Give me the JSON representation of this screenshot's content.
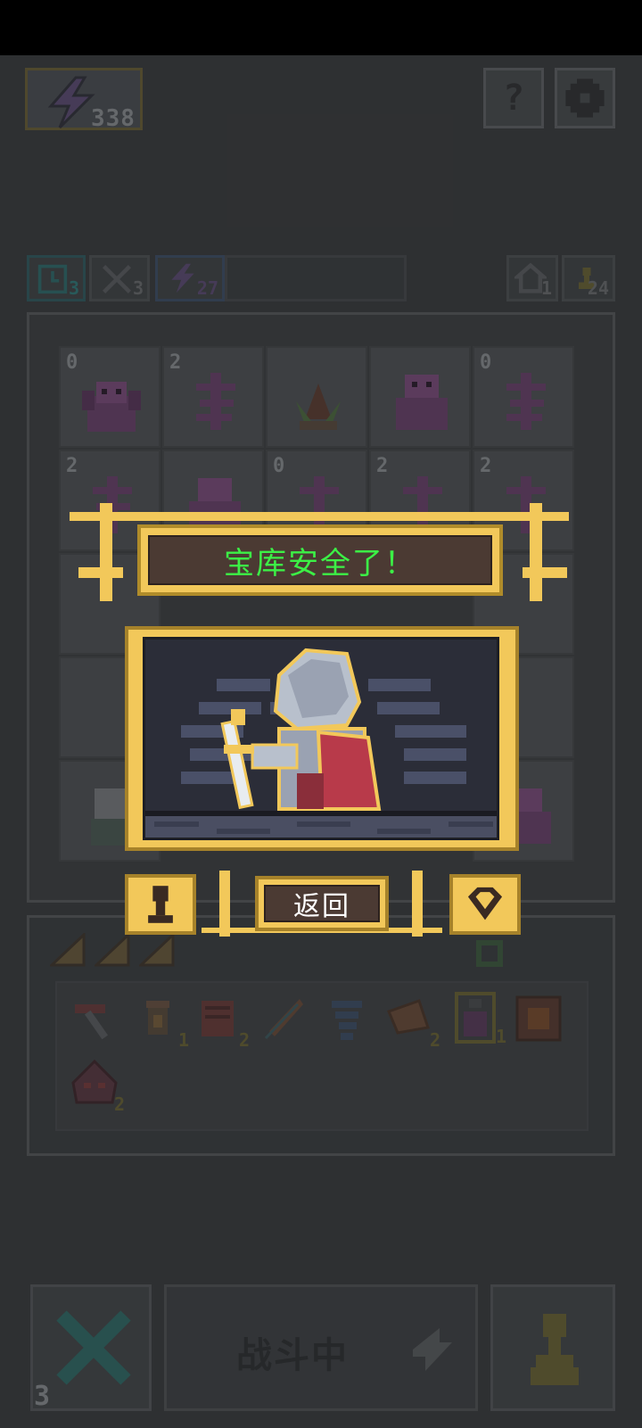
{
  "hud": {
    "energy": "338",
    "help_icon": "question-icon",
    "settings_icon": "gear-icon"
  },
  "stats": {
    "clock": "3",
    "swords": "3",
    "energy": "27",
    "home": "1",
    "pawn": "24"
  },
  "grid": {
    "rows": [
      [
        {
          "level": "0",
          "monster": "dragon"
        },
        {
          "level": "2",
          "monster": "skeleton"
        },
        {
          "level": "",
          "monster": "plant"
        },
        {
          "level": "",
          "monster": "golem"
        },
        {
          "level": "0",
          "monster": "skeleton"
        }
      ],
      [
        {
          "level": "2",
          "monster": "skeleton"
        },
        {
          "level": "",
          "monster": "golem"
        },
        {
          "level": "0",
          "monster": "skeleton"
        },
        {
          "level": "2",
          "monster": "skeleton"
        },
        {
          "level": "2",
          "monster": "skeleton"
        }
      ]
    ]
  },
  "inventory": {
    "items": [
      {
        "icon": "pickaxe-icon",
        "count": ""
      },
      {
        "icon": "lantern-icon",
        "count": "1"
      },
      {
        "icon": "scroll-icon",
        "count": "2"
      },
      {
        "icon": "feather-icon",
        "count": ""
      },
      {
        "icon": "tornado-icon",
        "count": ""
      },
      {
        "icon": "horn-icon",
        "count": "2"
      },
      {
        "icon": "potion-icon",
        "count": "1"
      },
      {
        "icon": "orb-icon",
        "count": ""
      },
      {
        "icon": "demon-mask-icon",
        "count": "2"
      }
    ]
  },
  "modal": {
    "title": "宝库安全了！",
    "back_label": "返回"
  },
  "bottom": {
    "close_count": "3",
    "battle_label": "战斗中"
  },
  "colors": {
    "gold": "#f2c85a",
    "title_green": "#3cf046",
    "frame_brown": "#4b3a33",
    "monster_purple": "#6b3f6a"
  }
}
